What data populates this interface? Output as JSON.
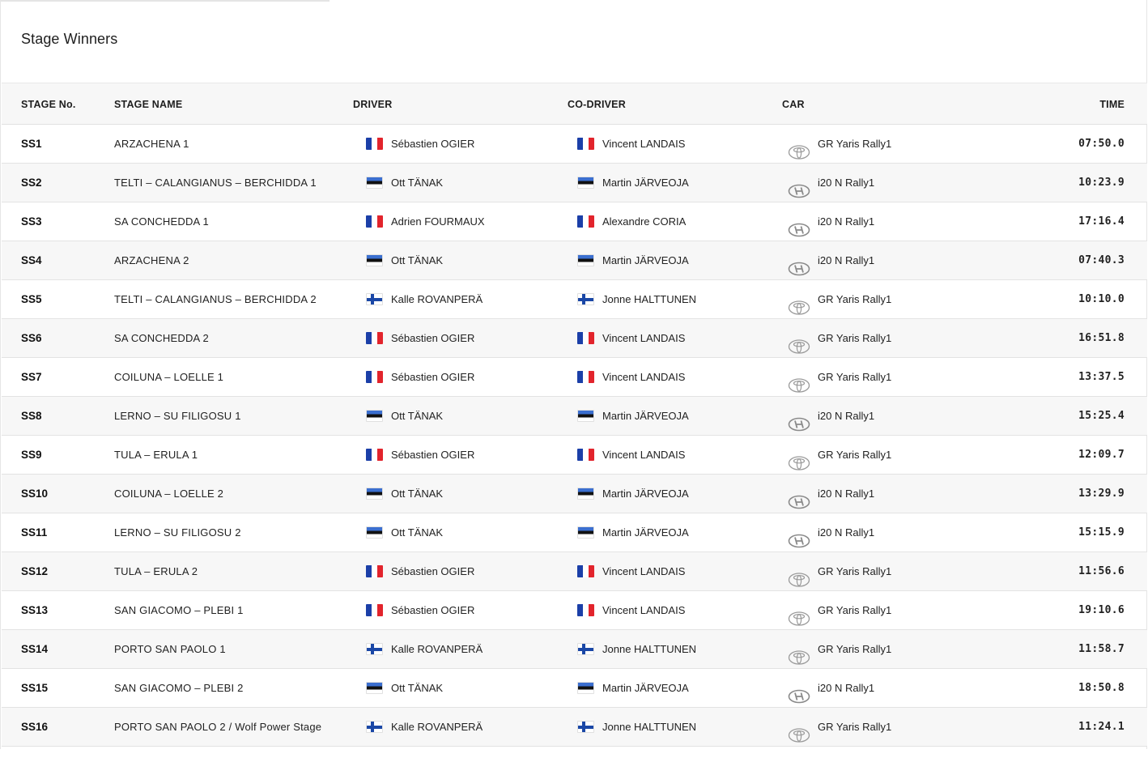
{
  "title": "Stage Winners",
  "columns": {
    "stage_no": "STAGE No.",
    "stage_name": "STAGE NAME",
    "driver": "DRIVER",
    "co_driver": "CO-DRIVER",
    "car": "CAR",
    "time": "TIME"
  },
  "rows": [
    {
      "stage": "SS1",
      "name": "ARZACHENA 1",
      "driver": "Sébastien OGIER",
      "driver_flag": "fr",
      "co_driver": "Vincent LANDAIS",
      "co_flag": "fr",
      "car_logo": "toyota-logo-icon",
      "car": "GR Yaris Rally1",
      "time": "07:50.0"
    },
    {
      "stage": "SS2",
      "name": "TELTI – CALANGIANUS – BERCHIDDA 1",
      "driver": "Ott TÄNAK",
      "driver_flag": "ee",
      "co_driver": "Martin JÄRVEOJA",
      "co_flag": "ee",
      "car_logo": "hyundai-logo-icon",
      "car": "i20 N Rally1",
      "time": "10:23.9"
    },
    {
      "stage": "SS3",
      "name": "SA CONCHEDDA 1",
      "driver": "Adrien FOURMAUX",
      "driver_flag": "fr",
      "co_driver": "Alexandre CORIA",
      "co_flag": "fr",
      "car_logo": "hyundai-logo-icon",
      "car": "i20 N Rally1",
      "time": "17:16.4"
    },
    {
      "stage": "SS4",
      "name": "ARZACHENA 2",
      "driver": "Ott TÄNAK",
      "driver_flag": "ee",
      "co_driver": "Martin JÄRVEOJA",
      "co_flag": "ee",
      "car_logo": "hyundai-logo-icon",
      "car": "i20 N Rally1",
      "time": "07:40.3"
    },
    {
      "stage": "SS5",
      "name": "TELTI – CALANGIANUS – BERCHIDDA 2",
      "driver": "Kalle ROVANPERÄ",
      "driver_flag": "fi",
      "co_driver": "Jonne HALTTUNEN",
      "co_flag": "fi",
      "car_logo": "toyota-logo-icon",
      "car": "GR Yaris Rally1",
      "time": "10:10.0"
    },
    {
      "stage": "SS6",
      "name": "SA CONCHEDDA 2",
      "driver": "Sébastien OGIER",
      "driver_flag": "fr",
      "co_driver": "Vincent LANDAIS",
      "co_flag": "fr",
      "car_logo": "toyota-logo-icon",
      "car": "GR Yaris Rally1",
      "time": "16:51.8"
    },
    {
      "stage": "SS7",
      "name": "COILUNA – LOELLE 1",
      "driver": "Sébastien OGIER",
      "driver_flag": "fr",
      "co_driver": "Vincent LANDAIS",
      "co_flag": "fr",
      "car_logo": "toyota-logo-icon",
      "car": "GR Yaris Rally1",
      "time": "13:37.5"
    },
    {
      "stage": "SS8",
      "name": "LERNO – SU FILIGOSU 1",
      "driver": "Ott TÄNAK",
      "driver_flag": "ee",
      "co_driver": "Martin JÄRVEOJA",
      "co_flag": "ee",
      "car_logo": "hyundai-logo-icon",
      "car": "i20 N Rally1",
      "time": "15:25.4"
    },
    {
      "stage": "SS9",
      "name": "TULA – ERULA 1",
      "driver": "Sébastien OGIER",
      "driver_flag": "fr",
      "co_driver": "Vincent LANDAIS",
      "co_flag": "fr",
      "car_logo": "toyota-logo-icon",
      "car": "GR Yaris Rally1",
      "time": "12:09.7"
    },
    {
      "stage": "SS10",
      "name": "COILUNA – LOELLE 2",
      "driver": "Ott TÄNAK",
      "driver_flag": "ee",
      "co_driver": "Martin JÄRVEOJA",
      "co_flag": "ee",
      "car_logo": "hyundai-logo-icon",
      "car": "i20 N Rally1",
      "time": "13:29.9"
    },
    {
      "stage": "SS11",
      "name": "LERNO – SU FILIGOSU 2",
      "driver": "Ott TÄNAK",
      "driver_flag": "ee",
      "co_driver": "Martin JÄRVEOJA",
      "co_flag": "ee",
      "car_logo": "hyundai-logo-icon",
      "car": "i20 N Rally1",
      "time": "15:15.9"
    },
    {
      "stage": "SS12",
      "name": "TULA – ERULA 2",
      "driver": "Sébastien OGIER",
      "driver_flag": "fr",
      "co_driver": "Vincent LANDAIS",
      "co_flag": "fr",
      "car_logo": "toyota-logo-icon",
      "car": "GR Yaris Rally1",
      "time": "11:56.6"
    },
    {
      "stage": "SS13",
      "name": "SAN GIACOMO – PLEBI 1",
      "driver": "Sébastien OGIER",
      "driver_flag": "fr",
      "co_driver": "Vincent LANDAIS",
      "co_flag": "fr",
      "car_logo": "toyota-logo-icon",
      "car": "GR Yaris Rally1",
      "time": "19:10.6"
    },
    {
      "stage": "SS14",
      "name": "PORTO SAN PAOLO 1",
      "driver": "Kalle ROVANPERÄ",
      "driver_flag": "fi",
      "co_driver": "Jonne HALTTUNEN",
      "co_flag": "fi",
      "car_logo": "toyota-logo-icon",
      "car": "GR Yaris Rally1",
      "time": "11:58.7"
    },
    {
      "stage": "SS15",
      "name": "SAN GIACOMO – PLEBI 2",
      "driver": "Ott TÄNAK",
      "driver_flag": "ee",
      "co_driver": "Martin JÄRVEOJA",
      "co_flag": "ee",
      "car_logo": "hyundai-logo-icon",
      "car": "i20 N Rally1",
      "time": "18:50.8"
    },
    {
      "stage": "SS16",
      "name": "PORTO SAN PAOLO 2 / Wolf Power Stage",
      "driver": "Kalle ROVANPERÄ",
      "driver_flag": "fi",
      "co_driver": "Jonne HALTTUNEN",
      "co_flag": "fi",
      "car_logo": "toyota-logo-icon",
      "car": "GR Yaris Rally1",
      "time": "11:24.1"
    }
  ]
}
